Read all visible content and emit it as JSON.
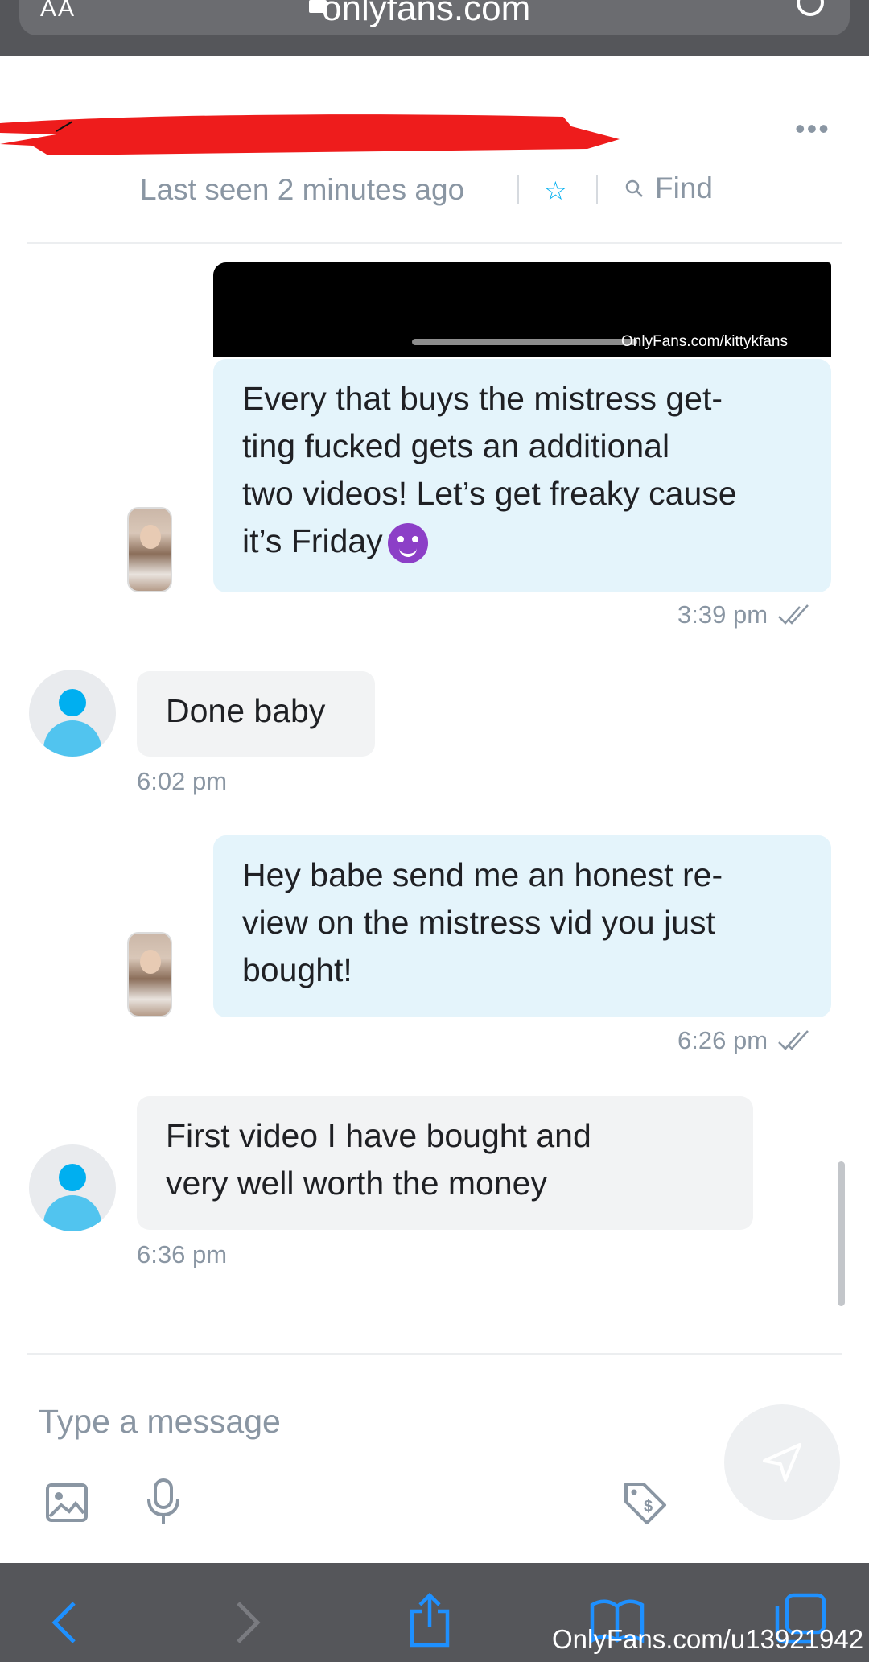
{
  "browser": {
    "text_size_label": "AA",
    "url": "onlyfans.com"
  },
  "header": {
    "last_seen": "Last seen 2 minutes ago",
    "find_label": "Find"
  },
  "messages": [
    {
      "direction": "outgoing",
      "media_watermark": "OnlyFans.com/kittykfans",
      "text_lines": [
        "Every that buys the mistress get-",
        "ting fucked gets an additional",
        "two videos! Let’s get freaky cause",
        "it’s Friday"
      ],
      "emoji": "smiling-imp",
      "time": "3:39 pm"
    },
    {
      "direction": "incoming",
      "text_lines": [
        "Done baby"
      ],
      "time": "6:02 pm"
    },
    {
      "direction": "outgoing",
      "text_lines": [
        "Hey babe send me an honest re-",
        "view on the mistress vid you just",
        "bought!"
      ],
      "time": "6:26 pm"
    },
    {
      "direction": "incoming",
      "text_lines": [
        "First video I have bought and",
        "very well worth the money"
      ],
      "time": "6:36 pm"
    }
  ],
  "composer": {
    "placeholder": "Type a message"
  },
  "watermark": "OnlyFans.com/u13921942",
  "colors": {
    "accent": "#00aff0",
    "outgoing_bubble": "#e4f4fb",
    "incoming_bubble": "#f2f3f4",
    "muted_text": "#8a96a3",
    "browser_bar": "#55565a"
  }
}
